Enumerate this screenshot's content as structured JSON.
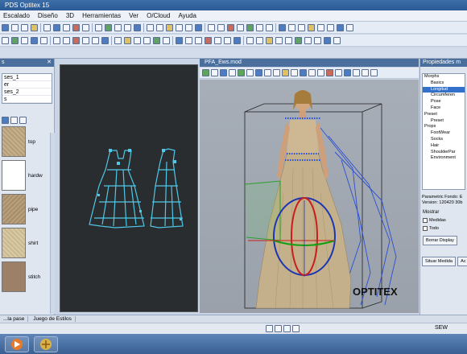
{
  "window": {
    "title": "PDS Optitex 15"
  },
  "menu": [
    "Escalado",
    "Diseño",
    "3D",
    "Herramientas",
    "Ver",
    "O/Cloud",
    "Ayuda"
  ],
  "left_panel": {
    "list": [
      "ses_1",
      "er",
      "ses_2",
      "s"
    ],
    "fabrics": [
      {
        "label": "top",
        "color": "#c6b08c"
      },
      {
        "label": "hardw",
        "color": "#ffffff"
      },
      {
        "label": "pipe",
        "color": "#b8a07c"
      },
      {
        "label": "shirt",
        "color": "#d9c9a4"
      },
      {
        "label": "stitch",
        "color": "#9c8068"
      }
    ]
  },
  "view3d": {
    "tab_label": "PFA_Ews.mod",
    "logo": "OPTITEX"
  },
  "props": {
    "title": "Propiedades m",
    "tree": [
      {
        "label": "Morphs",
        "indent": 0
      },
      {
        "label": "Basics",
        "indent": 1
      },
      {
        "label": "Longitud",
        "indent": 1,
        "selected": true
      },
      {
        "label": "Circumferen",
        "indent": 1
      },
      {
        "label": "Pose",
        "indent": 1
      },
      {
        "label": "Face",
        "indent": 1
      },
      {
        "label": "Preset",
        "indent": 0
      },
      {
        "label": "Preset",
        "indent": 1
      },
      {
        "label": "Props",
        "indent": 0
      },
      {
        "label": "FootWear",
        "indent": 1
      },
      {
        "label": "Socks",
        "indent": 1
      },
      {
        "label": "Hair",
        "indent": 1
      },
      {
        "label": "ShoulderPar",
        "indent": 1
      },
      {
        "label": "Environment",
        "indent": 1
      }
    ],
    "params_label": "Parametric Fondo: E",
    "version_label": "Version: 120420 30b",
    "mostrar": "Mostrar",
    "medidas": "Medidas",
    "todo": "Todo",
    "borrar_button": "Borrar Display",
    "situar_button": "Situar Medida",
    "extra_button": "Ac"
  },
  "bottom_tabs": [
    "...la pase",
    "Juego de Estilos"
  ],
  "status": {
    "right": "SEW"
  }
}
